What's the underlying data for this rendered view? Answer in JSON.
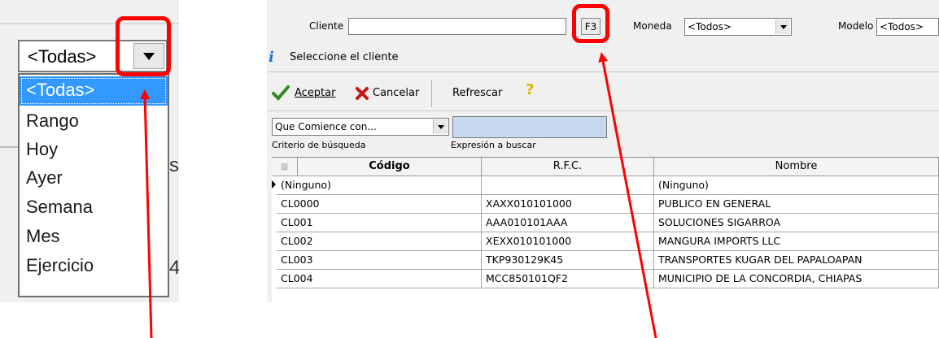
{
  "left_panel": {
    "combo_value": "<Todas>",
    "options": [
      "<Todas>",
      "Rango",
      "Hoy",
      "Ayer",
      "Semana",
      "Mes",
      "Ejercicio"
    ],
    "selected_index": 0,
    "side_fragment_1": "s",
    "side_fragment_2": "4"
  },
  "toolbar": {
    "cliente_label": "Cliente",
    "cliente_value": "",
    "f3_label": "F3",
    "moneda_label": "Moneda",
    "moneda_value": "<Todos>",
    "modelo_label": "Modelo",
    "modelo_value": "<Todos>"
  },
  "info": {
    "text": "Seleccione el cliente"
  },
  "actions": {
    "aceptar": "Aceptar",
    "cancelar": "Cancelar",
    "refrescar": "Refrescar"
  },
  "search": {
    "criterio_value": "Que Comience con...",
    "criterio_label": "Criterio de búsqueda",
    "expresion_value": "",
    "expresion_label": "Expresión a buscar"
  },
  "grid": {
    "columns": [
      "Código",
      "R.F.C.",
      "Nombre"
    ],
    "rows": [
      [
        "(Ninguno)",
        "",
        "(Ninguno)"
      ],
      [
        "CL0000",
        "XAXX010101000",
        "PUBLICO EN GENERAL"
      ],
      [
        "CL001",
        "AAA010101AAA",
        "SOLUCIONES SIGARROA"
      ],
      [
        "CL002",
        "XEXX010101000",
        "MANGURA IMPORTS LLC"
      ],
      [
        "CL003",
        "TKP930129K45",
        "TRANSPORTES KUGAR DEL PAPALOAPAN"
      ],
      [
        "CL004",
        "MCC850101QF2",
        "MUNICIPIO DE LA CONCORDIA, CHIAPAS"
      ]
    ]
  },
  "colors": {
    "highlight_red": "#ff0000",
    "selection_blue": "#3399ff",
    "search_field": "#c6d9f1"
  }
}
